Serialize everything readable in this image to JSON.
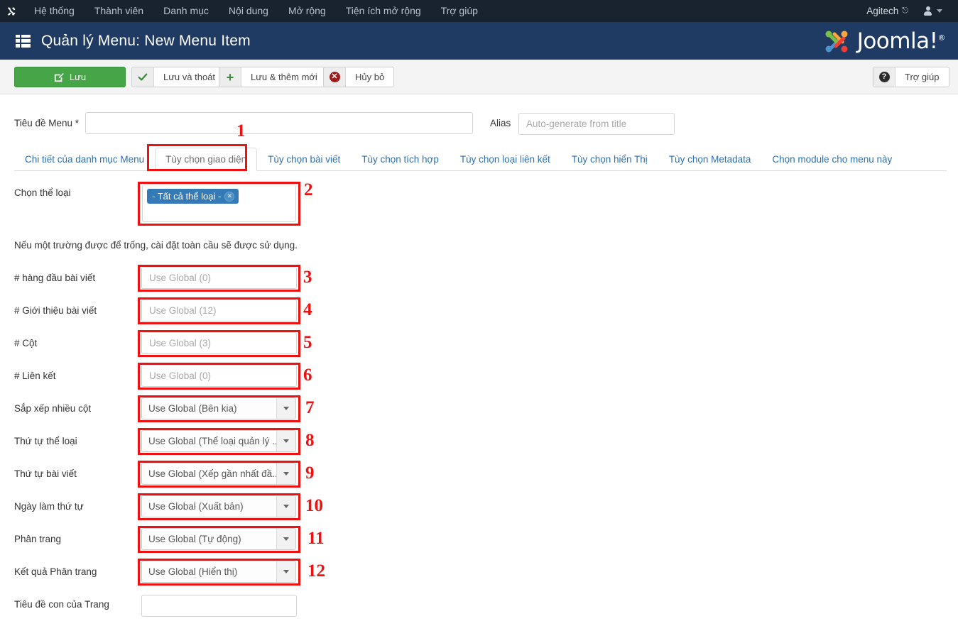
{
  "topnav": {
    "logo_icon": "joomla-logo-icon",
    "items": [
      {
        "label": "Hệ thống"
      },
      {
        "label": "Thành viên"
      },
      {
        "label": "Danh mục"
      },
      {
        "label": "Nội dung"
      },
      {
        "label": "Mở rộng"
      },
      {
        "label": "Tiện ích mở rộng"
      },
      {
        "label": "Trợ giúp"
      }
    ],
    "site_name": "Agitech",
    "external_link_icon": "external-link-icon",
    "user_icon": "user-icon",
    "caret_icon": "chevron-down-icon"
  },
  "titlebar": {
    "icon": "menu-list-icon",
    "title": "Quản lý Menu: New Menu Item",
    "brand": "Joomla!",
    "brand_sup": "®"
  },
  "toolbar": {
    "save": {
      "label": "Lưu",
      "icon": "save-pencil-icon"
    },
    "save_close": {
      "label": "Lưu và thoát",
      "icon": "check-icon"
    },
    "save_new": {
      "label": "Lưu & thêm mới",
      "icon": "plus-icon"
    },
    "cancel": {
      "label": "Hủy bỏ",
      "icon": "cancel-circle-icon"
    },
    "help": {
      "label": "Trợ giúp",
      "icon": "question-circle-icon"
    }
  },
  "form": {
    "title_label": "Tiêu đề Menu *",
    "title_value": "",
    "title_placeholder": "",
    "alias_label": "Alias",
    "alias_value": "",
    "alias_placeholder": "Auto-generate from title"
  },
  "tabs": [
    {
      "label": "Chi tiết của danh mục Menu",
      "active": false
    },
    {
      "label": "Tùy chọn giao diện",
      "active": true
    },
    {
      "label": "Tùy chọn bài viết",
      "active": false
    },
    {
      "label": "Tùy chọn tích hợp",
      "active": false
    },
    {
      "label": "Tùy chọn loại liên kết",
      "active": false
    },
    {
      "label": "Tùy chọn hiển Thị",
      "active": false
    },
    {
      "label": "Tùy chọn Metadata",
      "active": false
    },
    {
      "label": "Chọn module cho menu này",
      "active": false
    }
  ],
  "panel": {
    "category_label": "Chọn thể loại",
    "category_chip": "- Tất cả thể loại -",
    "category_chip_remove_icon": "remove-circle-icon",
    "hint": "Nếu một trường được để trống, cài đặt toàn cầu sẽ được sử dụng.",
    "fields": [
      {
        "label": "# hàng đầu bài viết",
        "type": "text",
        "value": "",
        "placeholder": "Use Global (0)"
      },
      {
        "label": "# Giới thiệu bài viết",
        "type": "text",
        "value": "",
        "placeholder": "Use Global (12)"
      },
      {
        "label": "# Cột",
        "type": "text",
        "value": "",
        "placeholder": "Use Global (3)"
      },
      {
        "label": "# Liên kết",
        "type": "text",
        "value": "",
        "placeholder": "Use Global (0)"
      },
      {
        "label": "Sắp xếp nhiều cột",
        "type": "select",
        "value": "Use Global (Bên kia)"
      },
      {
        "label": "Thứ tự thể loại",
        "type": "select",
        "value": "Use Global (Thể loại quản lý ..."
      },
      {
        "label": "Thứ tự bài viết",
        "type": "select",
        "value": "Use Global (Xếp gần nhất đầ..."
      },
      {
        "label": "Ngày làm thứ tự",
        "type": "select",
        "value": "Use Global (Xuất bản)"
      },
      {
        "label": "Phân trang",
        "type": "select",
        "value": "Use Global (Tự động)"
      },
      {
        "label": "Kết quả Phân trang",
        "type": "select",
        "value": "Use Global (Hiển thị)"
      },
      {
        "label": "Tiêu đề con của Trang",
        "type": "text",
        "value": "",
        "placeholder": ""
      }
    ]
  },
  "annotations": {
    "numbers": [
      "1",
      "2",
      "3",
      "4",
      "5",
      "6",
      "7",
      "8",
      "9",
      "10",
      "11",
      "12"
    ]
  },
  "colors": {
    "topnav_bg": "#19232f",
    "titlebar_bg": "#1f3a63",
    "save_green": "#46a546",
    "tab_link_blue": "#2f6fad",
    "chip_blue": "#337ab7",
    "annotation_red": "#ee1111"
  }
}
